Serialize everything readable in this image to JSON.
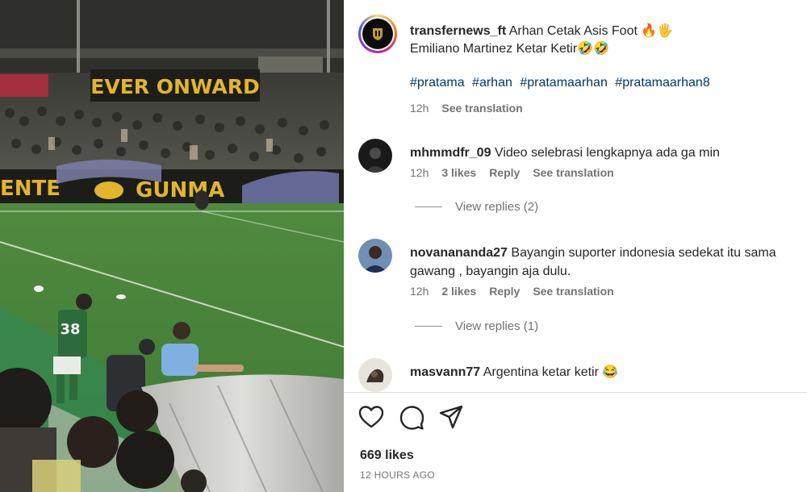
{
  "video": {
    "banner_top": "EVER ONWARD",
    "banner_bottom": "GUNMA",
    "banner_bottom_left": "ENTE",
    "player_number": "38"
  },
  "post": {
    "username": "transfernews_ft",
    "caption_line1": "Arhan Cetak Asis Foot 🔥🖐",
    "caption_line2": "Emiliano Martinez Ketar Ketir🤣🤣",
    "hashtags": [
      "#pratama",
      "#arhan",
      "#pratamaarhan",
      "#pratamaarhan8"
    ],
    "time": "12h",
    "see_translation": "See translation"
  },
  "comments": [
    {
      "username": "mhmmdfr_09",
      "text": "Video selebrasi lengkapnya ada ga min",
      "time": "12h",
      "likes": "3 likes",
      "reply": "Reply",
      "see_translation": "See translation",
      "view_replies": "View replies (2)"
    },
    {
      "username": "novanananda27",
      "text": "Bayangin suporter indonesia sedekat itu sama gawang , bayangin aja dulu.",
      "time": "12h",
      "likes": "2 likes",
      "reply": "Reply",
      "see_translation": "See translation",
      "view_replies": "View replies (1)"
    },
    {
      "username": "masvann77",
      "text": "Argentina ketar ketir 😂"
    }
  ],
  "footer": {
    "likes": "669 likes",
    "time_ago": "12 HOURS AGO"
  },
  "icons": {
    "like": "heart-icon",
    "comment": "comment-icon",
    "share": "share-icon"
  }
}
